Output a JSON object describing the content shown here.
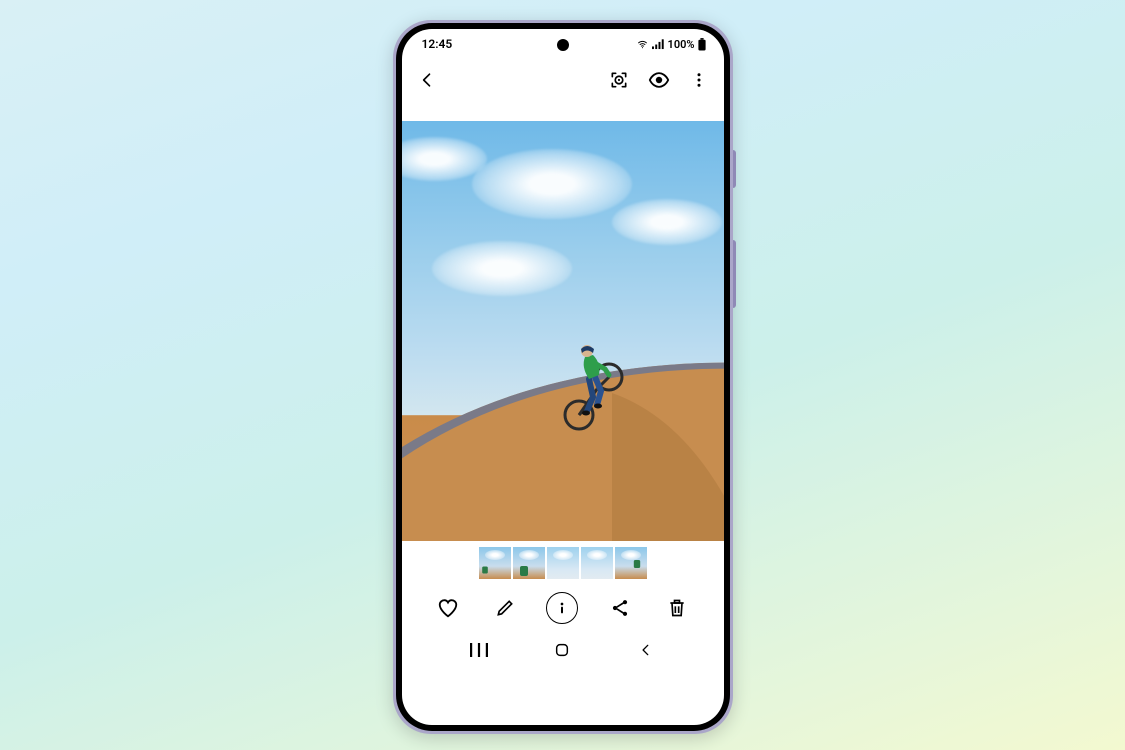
{
  "status": {
    "time": "12:45",
    "battery_percent": "100%"
  },
  "icons": {
    "wifi": "wifi-icon",
    "signal": "signal-icon",
    "battery": "battery-icon",
    "back": "chevron-left-icon",
    "bixby": "bixby-vision-icon",
    "eye": "eye-icon",
    "more": "more-vert-icon",
    "heart": "heart-icon",
    "pencil": "pencil-icon",
    "info": "info-icon",
    "share": "share-icon",
    "trash": "trash-icon",
    "recents": "recents-nav-icon",
    "home": "home-nav-icon",
    "back_nav": "back-nav-icon"
  },
  "thumbnails": 5
}
